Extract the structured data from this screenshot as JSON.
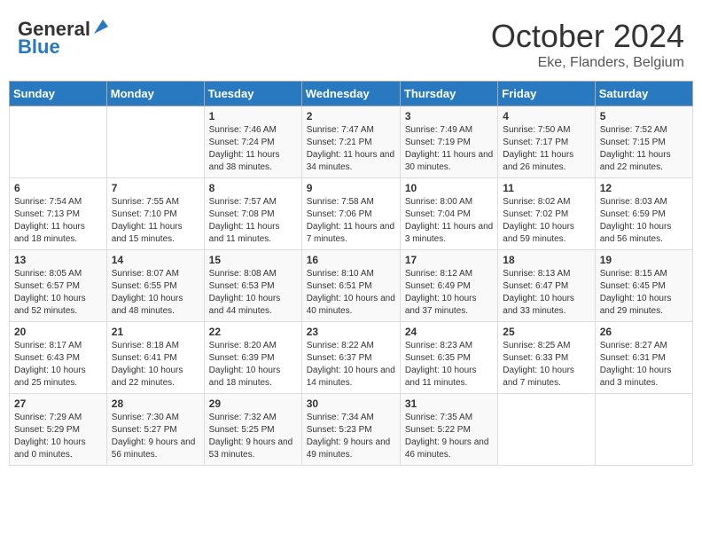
{
  "header": {
    "logo_line1": "General",
    "logo_line2": "Blue",
    "title": "October 2024",
    "subtitle": "Eke, Flanders, Belgium"
  },
  "days_of_week": [
    "Sunday",
    "Monday",
    "Tuesday",
    "Wednesday",
    "Thursday",
    "Friday",
    "Saturday"
  ],
  "weeks": [
    [
      {
        "num": "",
        "info": ""
      },
      {
        "num": "",
        "info": ""
      },
      {
        "num": "1",
        "info": "Sunrise: 7:46 AM\nSunset: 7:24 PM\nDaylight: 11 hours and 38 minutes."
      },
      {
        "num": "2",
        "info": "Sunrise: 7:47 AM\nSunset: 7:21 PM\nDaylight: 11 hours and 34 minutes."
      },
      {
        "num": "3",
        "info": "Sunrise: 7:49 AM\nSunset: 7:19 PM\nDaylight: 11 hours and 30 minutes."
      },
      {
        "num": "4",
        "info": "Sunrise: 7:50 AM\nSunset: 7:17 PM\nDaylight: 11 hours and 26 minutes."
      },
      {
        "num": "5",
        "info": "Sunrise: 7:52 AM\nSunset: 7:15 PM\nDaylight: 11 hours and 22 minutes."
      }
    ],
    [
      {
        "num": "6",
        "info": "Sunrise: 7:54 AM\nSunset: 7:13 PM\nDaylight: 11 hours and 18 minutes."
      },
      {
        "num": "7",
        "info": "Sunrise: 7:55 AM\nSunset: 7:10 PM\nDaylight: 11 hours and 15 minutes."
      },
      {
        "num": "8",
        "info": "Sunrise: 7:57 AM\nSunset: 7:08 PM\nDaylight: 11 hours and 11 minutes."
      },
      {
        "num": "9",
        "info": "Sunrise: 7:58 AM\nSunset: 7:06 PM\nDaylight: 11 hours and 7 minutes."
      },
      {
        "num": "10",
        "info": "Sunrise: 8:00 AM\nSunset: 7:04 PM\nDaylight: 11 hours and 3 minutes."
      },
      {
        "num": "11",
        "info": "Sunrise: 8:02 AM\nSunset: 7:02 PM\nDaylight: 10 hours and 59 minutes."
      },
      {
        "num": "12",
        "info": "Sunrise: 8:03 AM\nSunset: 6:59 PM\nDaylight: 10 hours and 56 minutes."
      }
    ],
    [
      {
        "num": "13",
        "info": "Sunrise: 8:05 AM\nSunset: 6:57 PM\nDaylight: 10 hours and 52 minutes."
      },
      {
        "num": "14",
        "info": "Sunrise: 8:07 AM\nSunset: 6:55 PM\nDaylight: 10 hours and 48 minutes."
      },
      {
        "num": "15",
        "info": "Sunrise: 8:08 AM\nSunset: 6:53 PM\nDaylight: 10 hours and 44 minutes."
      },
      {
        "num": "16",
        "info": "Sunrise: 8:10 AM\nSunset: 6:51 PM\nDaylight: 10 hours and 40 minutes."
      },
      {
        "num": "17",
        "info": "Sunrise: 8:12 AM\nSunset: 6:49 PM\nDaylight: 10 hours and 37 minutes."
      },
      {
        "num": "18",
        "info": "Sunrise: 8:13 AM\nSunset: 6:47 PM\nDaylight: 10 hours and 33 minutes."
      },
      {
        "num": "19",
        "info": "Sunrise: 8:15 AM\nSunset: 6:45 PM\nDaylight: 10 hours and 29 minutes."
      }
    ],
    [
      {
        "num": "20",
        "info": "Sunrise: 8:17 AM\nSunset: 6:43 PM\nDaylight: 10 hours and 25 minutes."
      },
      {
        "num": "21",
        "info": "Sunrise: 8:18 AM\nSunset: 6:41 PM\nDaylight: 10 hours and 22 minutes."
      },
      {
        "num": "22",
        "info": "Sunrise: 8:20 AM\nSunset: 6:39 PM\nDaylight: 10 hours and 18 minutes."
      },
      {
        "num": "23",
        "info": "Sunrise: 8:22 AM\nSunset: 6:37 PM\nDaylight: 10 hours and 14 minutes."
      },
      {
        "num": "24",
        "info": "Sunrise: 8:23 AM\nSunset: 6:35 PM\nDaylight: 10 hours and 11 minutes."
      },
      {
        "num": "25",
        "info": "Sunrise: 8:25 AM\nSunset: 6:33 PM\nDaylight: 10 hours and 7 minutes."
      },
      {
        "num": "26",
        "info": "Sunrise: 8:27 AM\nSunset: 6:31 PM\nDaylight: 10 hours and 3 minutes."
      }
    ],
    [
      {
        "num": "27",
        "info": "Sunrise: 7:29 AM\nSunset: 5:29 PM\nDaylight: 10 hours and 0 minutes."
      },
      {
        "num": "28",
        "info": "Sunrise: 7:30 AM\nSunset: 5:27 PM\nDaylight: 9 hours and 56 minutes."
      },
      {
        "num": "29",
        "info": "Sunrise: 7:32 AM\nSunset: 5:25 PM\nDaylight: 9 hours and 53 minutes."
      },
      {
        "num": "30",
        "info": "Sunrise: 7:34 AM\nSunset: 5:23 PM\nDaylight: 9 hours and 49 minutes."
      },
      {
        "num": "31",
        "info": "Sunrise: 7:35 AM\nSunset: 5:22 PM\nDaylight: 9 hours and 46 minutes."
      },
      {
        "num": "",
        "info": ""
      },
      {
        "num": "",
        "info": ""
      }
    ]
  ]
}
